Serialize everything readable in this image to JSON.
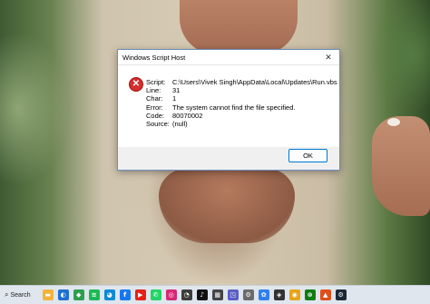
{
  "dialog": {
    "title": "Windows Script Host",
    "close_glyph": "✕",
    "icon": "error-icon",
    "fields": [
      {
        "label": "Script:",
        "value": "C:\\Users\\Vivek Singh\\AppData\\Local\\Updates\\Run.vbs"
      },
      {
        "label": "Line:",
        "value": "31"
      },
      {
        "label": "Char:",
        "value": "1"
      },
      {
        "label": "Error:",
        "value": "The system cannot find the file specified."
      },
      {
        "label": "Code:",
        "value": "80070002"
      },
      {
        "label": "Source:",
        "value": "(null)"
      }
    ],
    "ok_label": "OK"
  },
  "taskbar": {
    "search_label": "Search",
    "apps": [
      {
        "name": "file-explorer-icon",
        "color": "#f2b43a",
        "glyph": "▬"
      },
      {
        "name": "browser-icon",
        "color": "#1f6fd1",
        "glyph": "◐"
      },
      {
        "name": "maps-icon",
        "color": "#2e9e4f",
        "glyph": "◆"
      },
      {
        "name": "spotify-icon",
        "color": "#1db954",
        "glyph": "≋"
      },
      {
        "name": "edge-icon",
        "color": "#0c8ad6",
        "glyph": "◕"
      },
      {
        "name": "facebook-icon",
        "color": "#1877f2",
        "glyph": "f"
      },
      {
        "name": "youtube-icon",
        "color": "#e62117",
        "glyph": "▶"
      },
      {
        "name": "whatsapp-icon",
        "color": "#25d366",
        "glyph": "✆"
      },
      {
        "name": "instagram-icon",
        "color": "#d62976",
        "glyph": "◎"
      },
      {
        "name": "app-icon",
        "color": "#3c3c3c",
        "glyph": "◔"
      },
      {
        "name": "tiktok-icon",
        "color": "#111111",
        "glyph": "♪"
      },
      {
        "name": "app-icon",
        "color": "#444444",
        "glyph": "▦"
      },
      {
        "name": "app-icon",
        "color": "#5b5fc7",
        "glyph": "◳"
      },
      {
        "name": "app-icon",
        "color": "#6b6b6b",
        "glyph": "⚙"
      },
      {
        "name": "app-icon",
        "color": "#2f80ed",
        "glyph": "✿"
      },
      {
        "name": "app-icon",
        "color": "#333333",
        "glyph": "◈"
      },
      {
        "name": "chrome-icon",
        "color": "#e8a317",
        "glyph": "◉"
      },
      {
        "name": "xbox-icon",
        "color": "#107c10",
        "glyph": "⊗"
      },
      {
        "name": "app-icon",
        "color": "#e04f1a",
        "glyph": "▲"
      },
      {
        "name": "steam-icon",
        "color": "#1b2838",
        "glyph": "⚙"
      }
    ]
  }
}
